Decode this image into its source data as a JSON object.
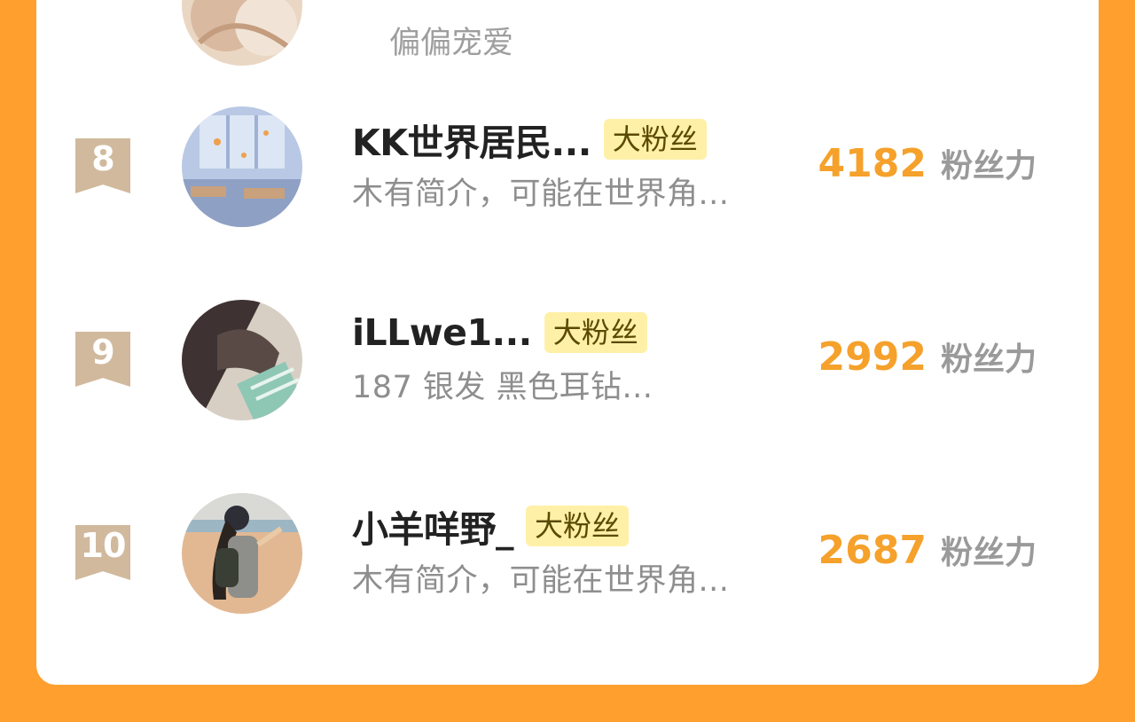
{
  "partial_row": {
    "bio": "偏偏宠爱"
  },
  "rows": [
    {
      "rank": "8",
      "name": "KK世界居民...",
      "badge": "大粉丝",
      "bio": "木有简介，可能在世界角...",
      "score": "4182",
      "score_label": "粉丝力",
      "avatar_icon": "classroom-avatar"
    },
    {
      "rank": "9",
      "name": "iLLwe1...",
      "badge": "大粉丝",
      "bio": "187 银发 黑色耳钻...",
      "score": "2992",
      "score_label": "粉丝力",
      "avatar_icon": "person-avatar"
    },
    {
      "rank": "10",
      "name": "小羊咩野_",
      "badge": "大粉丝",
      "bio": "木有简介，可能在世界角...",
      "score": "2687",
      "score_label": "粉丝力",
      "avatar_icon": "beach-avatar"
    }
  ],
  "colors": {
    "background": "#FF9F2E",
    "score": "#F5A12B",
    "badge_bg": "#FFF0A8",
    "rank_bg": "#D1B99D"
  }
}
